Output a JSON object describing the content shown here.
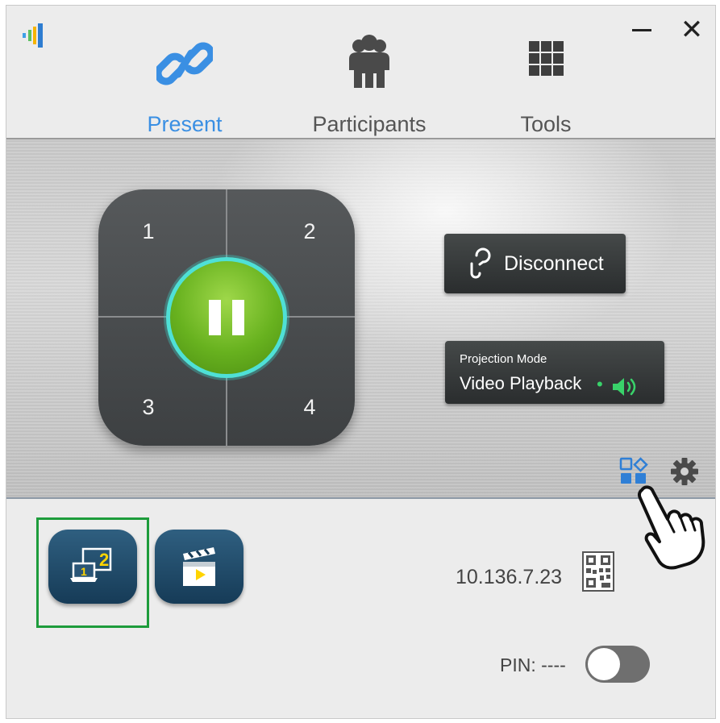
{
  "window": {
    "minimize_label": "minimize",
    "close_label": "✕"
  },
  "tabs": [
    {
      "label": "Present",
      "active": true,
      "icon": "link-icon"
    },
    {
      "label": "Participants",
      "active": false,
      "icon": "people-icon"
    },
    {
      "label": "Tools",
      "active": false,
      "icon": "grid-icon"
    }
  ],
  "present": {
    "quadrants": [
      "1",
      "2",
      "3",
      "4"
    ],
    "center_button": "pause",
    "disconnect_label": "Disconnect",
    "projection_mode": {
      "title": "Projection Mode",
      "value": "Video Playback",
      "separator": "•"
    }
  },
  "footer": {
    "ip_address": "10.136.7.23",
    "pin_label": "PIN: ----",
    "pin_toggle_on": false
  },
  "colors": {
    "active_tab": "#3a8fe3",
    "pause_green": "#68b21f",
    "pause_ring": "#4fe0d6",
    "selection_border": "#1d9c3b",
    "mode_button": "#1f4a69"
  }
}
